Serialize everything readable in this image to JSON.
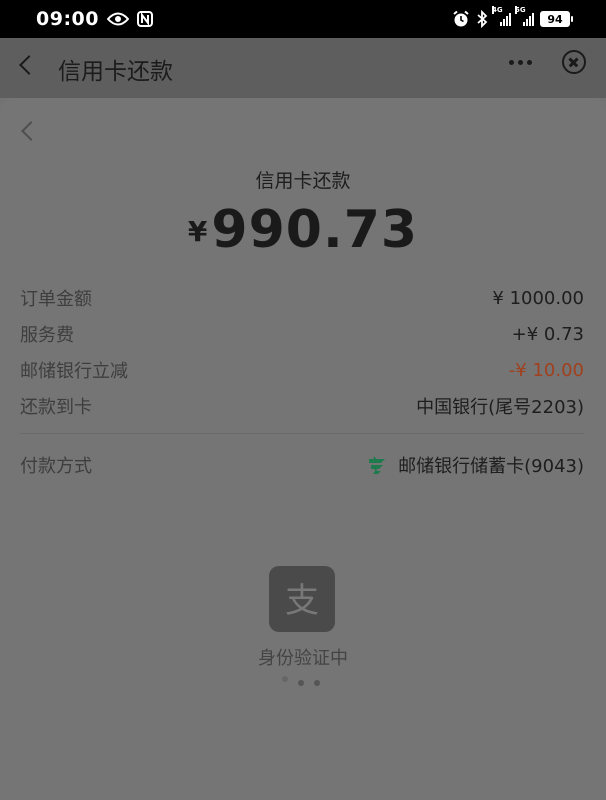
{
  "status_bar": {
    "time": "09:00",
    "left_icons": [
      "eye-icon",
      "nfc-icon"
    ],
    "right_icons": [
      "alarm-icon",
      "bluetooth-icon",
      "signal-4g-icon",
      "signal-5g-icon"
    ],
    "signal_1_label": "4G",
    "signal_2_label": "5G",
    "battery": "94"
  },
  "header": {
    "title": "信用卡还款"
  },
  "sheet": {
    "title": "信用卡还款",
    "currency": "¥",
    "amount": "990.73",
    "rows": [
      {
        "label": "订单金额",
        "value": "¥ 1000.00"
      },
      {
        "label": "服务费",
        "value": "+¥ 0.73"
      },
      {
        "label": "邮储银行立减",
        "value": "-¥ 10.00"
      },
      {
        "label": "还款到卡",
        "value": "中国银行(尾号2203)"
      }
    ],
    "payment": {
      "label": "付款方式",
      "method": "邮储银行储蓄卡(9043)"
    },
    "verify_text": "身份验证中",
    "alipay_logo_text": "支"
  },
  "colors": {
    "discount": "#a0401e",
    "bank_logo": "#1f7a4d"
  }
}
